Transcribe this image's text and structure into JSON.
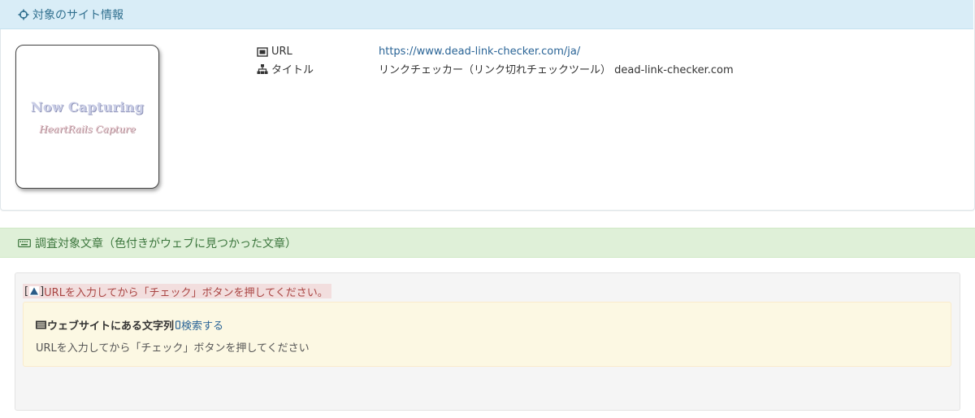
{
  "site_info": {
    "title": "対象のサイト情報",
    "thumbnail": {
      "line1": "Now Capturing",
      "line2": "HeartRails Capture"
    },
    "url_label": "URL",
    "url_value": "https://www.dead-link-checker.com/ja/",
    "title_label": "タイトル",
    "title_value": "リンクチェッカー（リンク切れチェックツール） dead-link-checker.com"
  },
  "investigation": {
    "title": "調査対象文章（色付きがウェブに見つかった文章）",
    "alert_open": "[",
    "alert_close": "]",
    "alert_text": "URLを入力してから「チェック」ボタンを押してください。",
    "box_title": "ウェブサイトにある文字列",
    "search_link": "検索する",
    "box_body": "URLを入力してから「チェック」ボタンを押してください"
  },
  "colors": {
    "info_header_bg": "#d9edf7",
    "info_header_text": "#31708f",
    "success_header_bg": "#dff0d8",
    "success_header_text": "#3c763d",
    "alert_bg": "#f2dede",
    "alert_text": "#a94442",
    "warning_bg": "#fcf8e3",
    "link": "#2a6496"
  },
  "icons": [
    "crosshair-icon",
    "screenshot-icon",
    "sitemap-icon",
    "keyboard-icon",
    "warning-triangle-icon",
    "list-icon",
    "search-icon"
  ]
}
